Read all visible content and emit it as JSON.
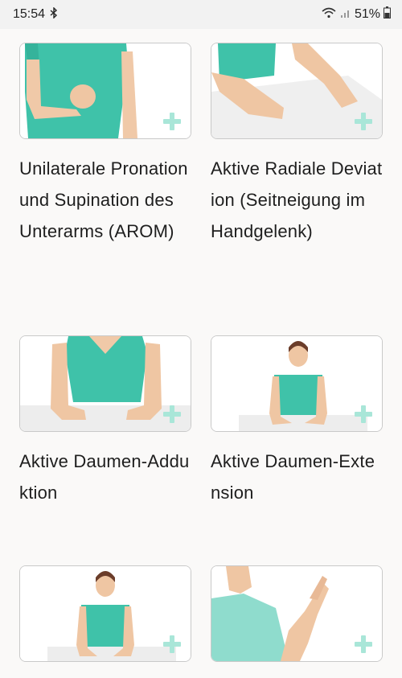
{
  "status_bar": {
    "time": "15:54",
    "battery_percent": "51%",
    "icons": [
      "bluetooth-icon",
      "wifi-icon",
      "signal-icon",
      "battery-icon"
    ]
  },
  "exercises": [
    {
      "title": "Unilaterale Pronation und Supination des Unterarms (AROM)"
    },
    {
      "title": "Aktive Radiale Deviation (Seitneigung im Handgelenk)"
    },
    {
      "title": "Aktive Daumen-Adduktion"
    },
    {
      "title": "Aktive Daumen-Extension"
    },
    {
      "title": ""
    },
    {
      "title": ""
    }
  ],
  "colors": {
    "shirt": "#3fc2a9",
    "accent_plus": "#a9e6d8",
    "background": "#faf9f8"
  }
}
